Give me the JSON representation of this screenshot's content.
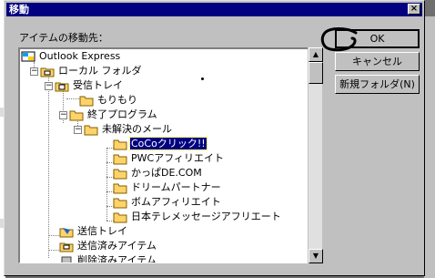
{
  "window": {
    "title": "移動",
    "close_glyph": "×"
  },
  "prompt_label": "アイテムの移動先：",
  "tree": {
    "items": [
      {
        "label": "Outlook Express",
        "icon": "outlook-express-icon"
      },
      {
        "label": "ローカル フォルダ",
        "icon": "local-folders-icon"
      },
      {
        "label": "受信トレイ",
        "icon": "inbox-icon"
      },
      {
        "label": "もりもり",
        "icon": "folder-icon"
      },
      {
        "label": "終了プログラム",
        "icon": "folder-icon"
      },
      {
        "label": "未解決のメール",
        "icon": "folder-icon"
      },
      {
        "label": "CoCoクリック!!",
        "icon": "folder-icon",
        "selected": true
      },
      {
        "label": "PWCアフィリエイト",
        "icon": "folder-icon"
      },
      {
        "label": "かっぱDE.COM",
        "icon": "folder-icon"
      },
      {
        "label": "ドリームパートナー",
        "icon": "folder-icon"
      },
      {
        "label": "ボムアフィリエイト",
        "icon": "folder-icon"
      },
      {
        "label": "日本テレメッセージアフリエート",
        "icon": "folder-icon"
      },
      {
        "label": "送信トレイ",
        "icon": "outbox-icon"
      },
      {
        "label": "送信済みアイテム",
        "icon": "sent-items-icon"
      },
      {
        "label": "削除済みアイテム",
        "icon": "deleted-items-icon"
      }
    ]
  },
  "buttons": {
    "ok": "OK",
    "cancel": "キャンセル",
    "new_folder": "新規フォルダ(N)"
  },
  "colors": {
    "title_bar": "#000080",
    "selection": "#000080",
    "dialog_face": "#c0c0c0"
  }
}
